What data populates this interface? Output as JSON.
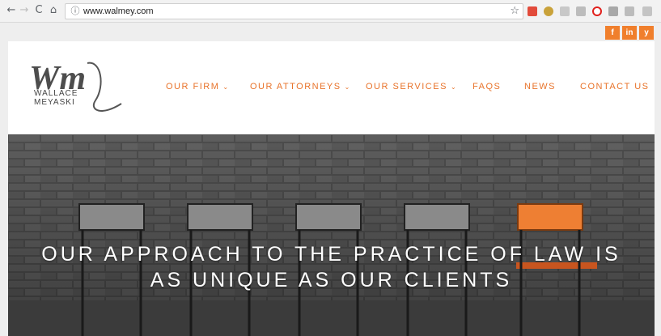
{
  "browser": {
    "url": "www.walmey.com",
    "back_icon": "←",
    "forward_icon": "→",
    "reload_icon": "C",
    "home_icon": "⌂",
    "info_icon": "ⓘ",
    "bookmark_icon": "☆"
  },
  "social": [
    {
      "name": "facebook",
      "glyph": "f"
    },
    {
      "name": "linkedin",
      "glyph": "in"
    },
    {
      "name": "twitter",
      "glyph": "y"
    }
  ],
  "logo": {
    "monogram": "Wm",
    "line1": "WALLACE",
    "line2": "MEYASKI"
  },
  "nav": {
    "firm": "OUR FIRM",
    "attorneys": "OUR ATTORNEYS",
    "services": "OUR SERVICES",
    "faqs": "FAQS",
    "news": "NEWS",
    "contact": "CONTACT US",
    "caret": "⌄"
  },
  "hero": {
    "line1": "OUR APPROACH TO THE PRACTICE OF LAW IS",
    "line2": "AS UNIQUE AS OUR CLIENTS"
  },
  "colors": {
    "accent": "#e8732a",
    "social_bg": "#f07f2c"
  }
}
